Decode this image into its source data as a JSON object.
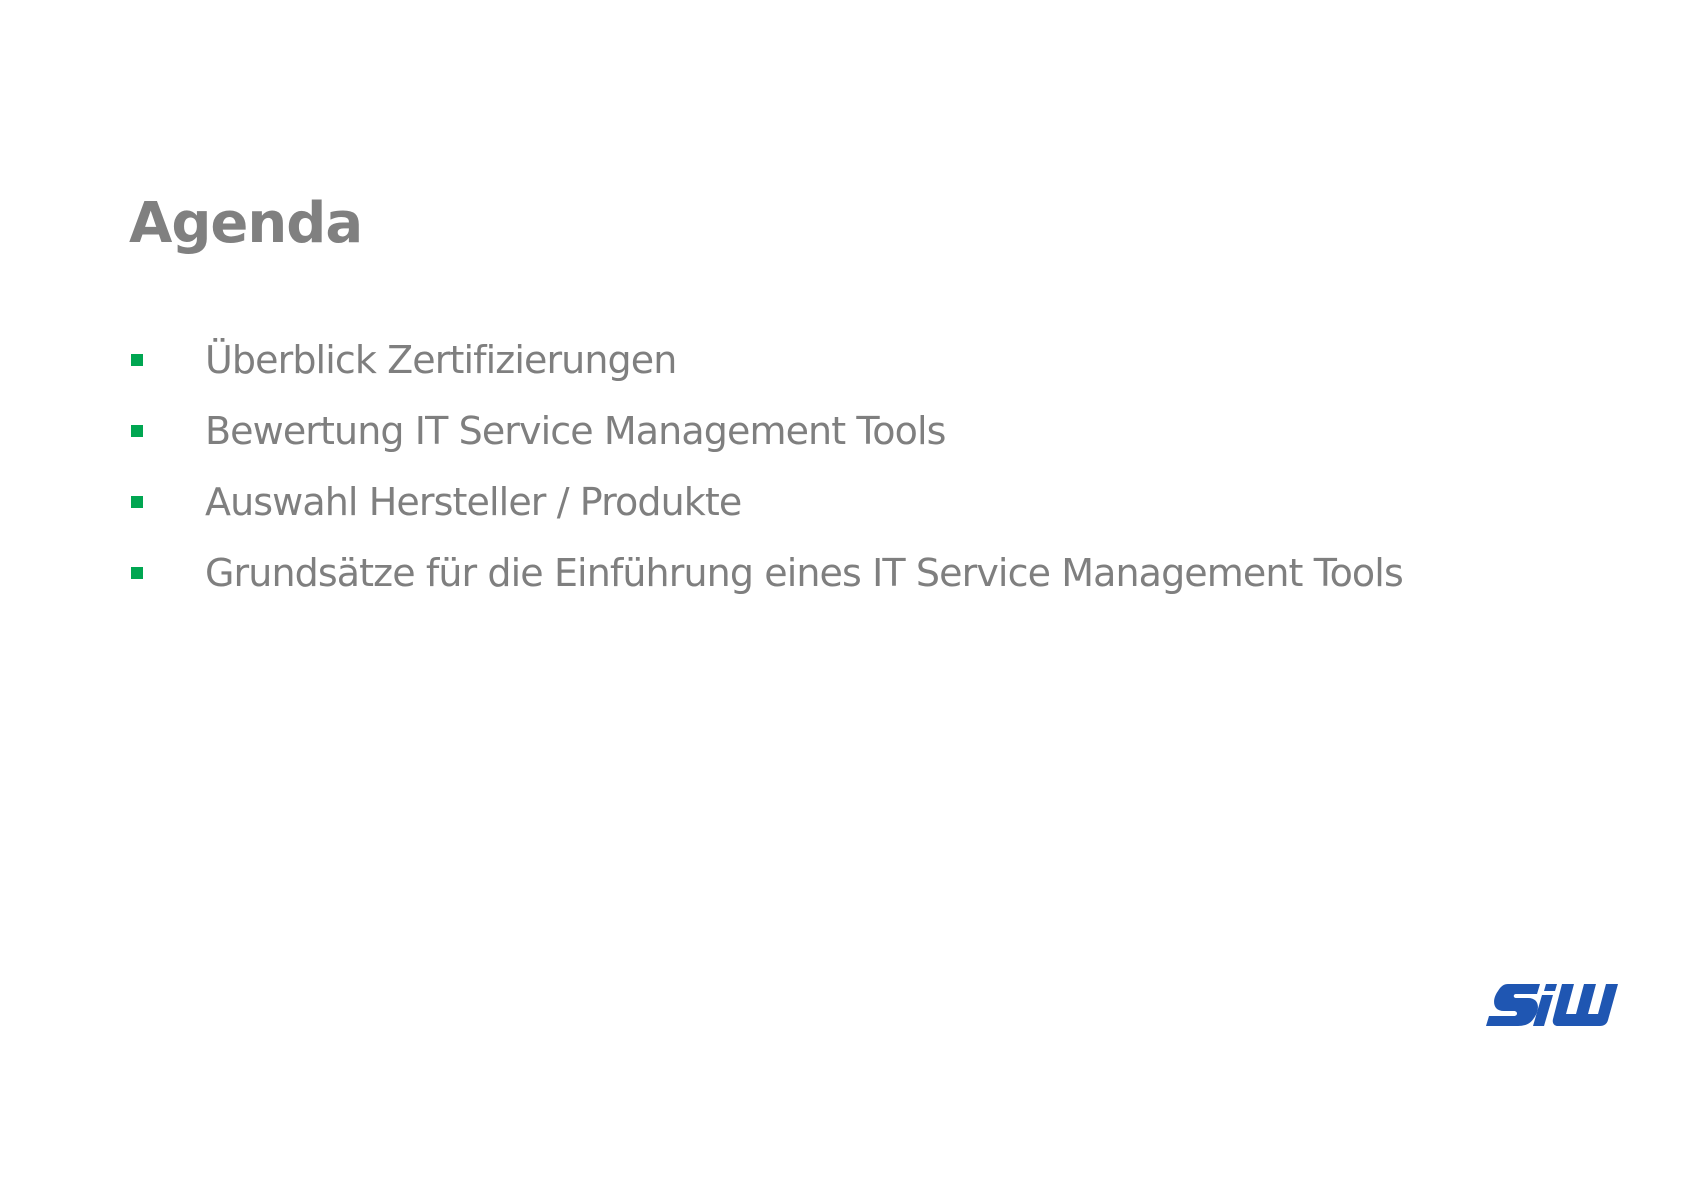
{
  "slide": {
    "title": "Agenda",
    "bullet_color": "#00a651",
    "text_color": "#7f7f7f",
    "items": [
      {
        "label": "Überblick Zertifizierungen",
        "icon": "square-bullet-icon"
      },
      {
        "label": "Bewertung IT Service Management Tools",
        "icon": "square-bullet-icon"
      },
      {
        "label": "Auswahl Hersteller / Produkte",
        "icon": "square-bullet-icon"
      },
      {
        "label": "Grundsätze für die Einführung eines IT Service Management Tools",
        "icon": "square-bullet-icon"
      }
    ]
  },
  "logo": {
    "text": "SiW",
    "color": "#1f56b2",
    "icon": "siw-logo-icon"
  }
}
